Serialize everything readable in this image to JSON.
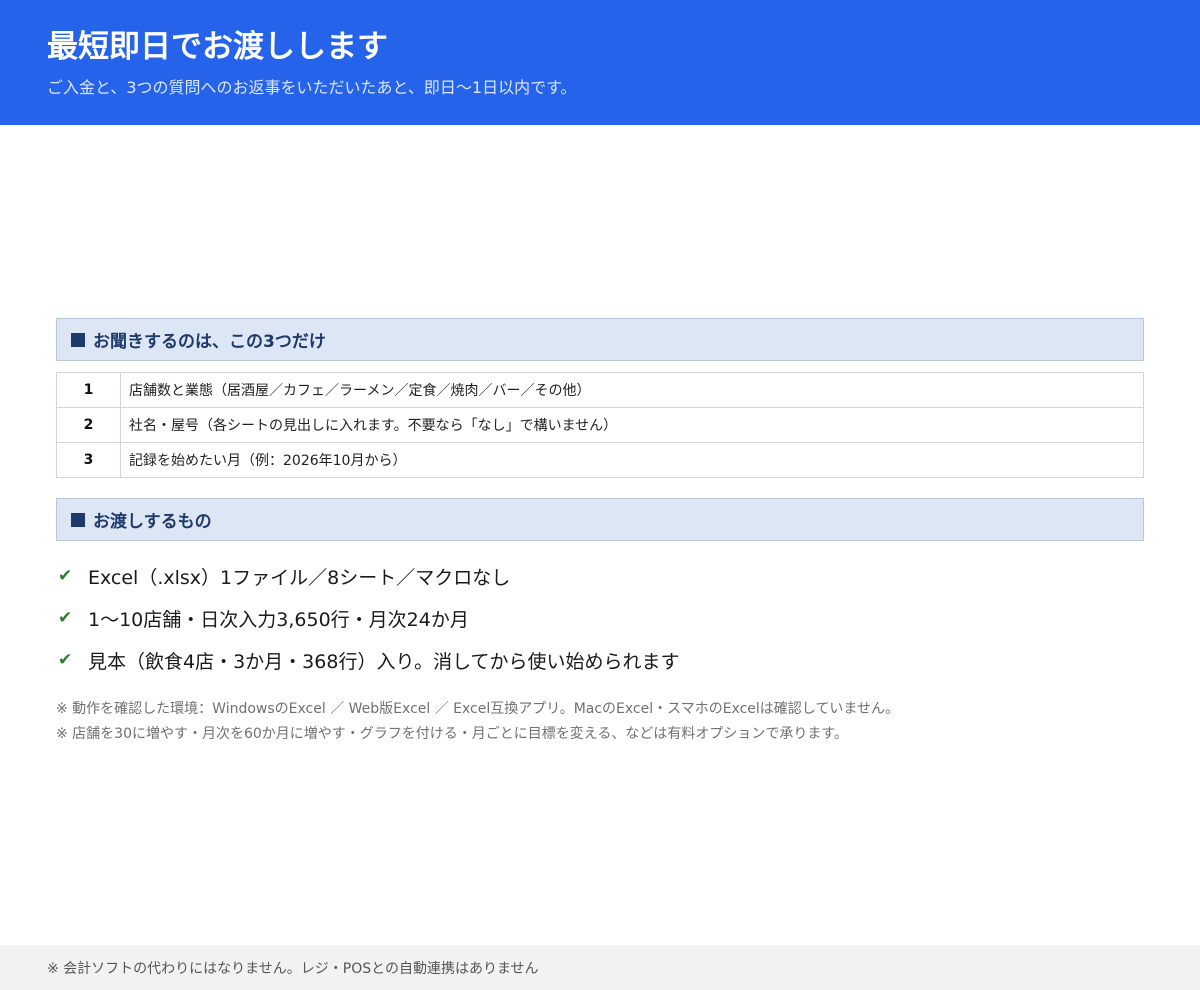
{
  "header": {
    "title": "最短即日でお渡しします",
    "subtitle": "ご入金と、3つの質問へのお返事をいただいたあと、即日〜1日以内です。"
  },
  "questions": {
    "heading": "お聞きするのは、この3つだけ",
    "heading_icon": "square-icon",
    "rows": [
      {
        "num": "1",
        "text": "店舗数と業態（居酒屋／カフェ／ラーメン／定食／焼肉／バー／その他）"
      },
      {
        "num": "2",
        "text": "社名・屋号（各シートの見出しに入れます。不要なら「なし」で構いません）"
      },
      {
        "num": "3",
        "text": "記録を始めたい月（例：2026年10月から）"
      }
    ]
  },
  "deliverables": {
    "heading": "お渡しするもの",
    "heading_icon": "square-icon",
    "item_icon": "check-icon",
    "check_color": "#2e7d32",
    "items": [
      "Excel（.xlsx）1ファイル／8シート／マクロなし",
      "1〜10店舗・日次入力3,650行・月次24か月",
      "見本（飲食4店・3か月・368行）入り。消してから使い始められます"
    ]
  },
  "notes": [
    "※ 動作を確認した環境：WindowsのExcel ／ Web版Excel ／ Excel互換アプリ。MacのExcel・スマホのExcelは確認していません。",
    "※ 店舗を30に増やす・月次を60か月に増やす・グラフを付ける・月ごとに目標を変える、などは有料オプションで承ります。"
  ],
  "footer": {
    "text": "※ 会計ソフトの代わりにはなりません。レジ・POSとの自動連携はありません"
  },
  "colors": {
    "header_bg": "#2563eb",
    "section_bg": "#dde6f4",
    "section_text": "#1e3a6a",
    "footer_bg": "#f2f2f2"
  }
}
